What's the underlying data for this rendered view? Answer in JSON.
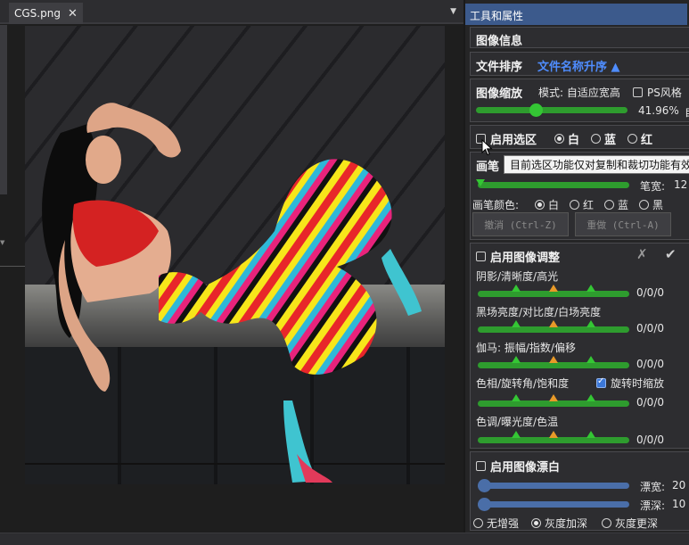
{
  "tab": {
    "filename": "CGS.png"
  },
  "panel": {
    "title": "工具和属性"
  },
  "image_info": {
    "label": "图像信息"
  },
  "sort": {
    "label": "文件排序",
    "value": "文件名称升序 ▲"
  },
  "zoom": {
    "label": "图像缩放",
    "mode_label": "模式: 自适应宽高",
    "ps_style_label": "PS风格",
    "percent_text": "41.96%",
    "cut_text": "自",
    "level": 0.4196
  },
  "selection": {
    "enable_label": "启用选区",
    "colors": [
      "白",
      "蓝",
      "红"
    ],
    "selected": "白",
    "tooltip": "目前选区功能仅对复制和裁切功能有效"
  },
  "brush": {
    "label_cut": "画笔",
    "width_label": "笔宽:",
    "width_value": "12",
    "color_label": "画笔颜色:",
    "colors": [
      "白",
      "红",
      "蓝",
      "黑"
    ],
    "selected_color": "白",
    "undo_label": "撤消 (Ctrl-Z)",
    "redo_label": "重做 (Ctrl-A)"
  },
  "adjust": {
    "enable_label": "启用图像调整",
    "cancel_icon": "✗",
    "apply_icon": "✔",
    "rows": [
      {
        "label": "阴影/清晰度/高光",
        "value": "0/0/0"
      },
      {
        "label": "黑场亮度/对比度/白场亮度",
        "value": "0/0/0"
      },
      {
        "label": "伽马: 振幅/指数/偏移",
        "value": "0/0/0"
      },
      {
        "label": "色相/旋转角/饱和度",
        "value": "0/0/0",
        "extra_label": "旋转时缩放"
      },
      {
        "label": "色调/曝光度/色温",
        "value": "0/0/0"
      }
    ]
  },
  "bleach": {
    "enable_label": "启用图像漂白",
    "width_label": "漂宽:",
    "width_value": "20",
    "depth_label": "漂深:",
    "depth_value": "10",
    "modes": [
      "无增强",
      "灰度加深",
      "灰度更深"
    ],
    "selected_mode": "灰度加深"
  },
  "colors": {
    "accent_blue": "#3c5a8c",
    "slider_green": "#2e9c2e",
    "slider_blue": "#4a6ea8",
    "marker_orange": "#e89a28"
  }
}
